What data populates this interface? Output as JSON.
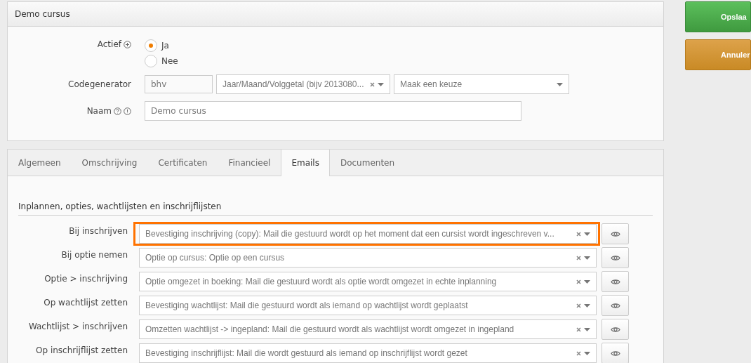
{
  "panel": {
    "title": "Demo cursus"
  },
  "form": {
    "actief": {
      "label": "Actief",
      "options": [
        {
          "label": "Ja",
          "selected": true
        },
        {
          "label": "Nee",
          "selected": false
        }
      ]
    },
    "codegenerator": {
      "label": "Codegenerator",
      "prefix": "bhv",
      "format": "Jaar/Maand/Volggetal (bijv 2013080...",
      "format_clearable": true,
      "choice_placeholder": "Maak een keuze"
    },
    "naam": {
      "label": "Naam",
      "value": "Demo cursus"
    }
  },
  "actions": [
    {
      "kind": "save",
      "label": "Opslaa"
    },
    {
      "kind": "cancel",
      "label": "Annuler"
    }
  ],
  "tabs": [
    {
      "label": "Algemeen",
      "selected": false
    },
    {
      "label": "Omschrijving",
      "selected": false
    },
    {
      "label": "Certificaten",
      "selected": false
    },
    {
      "label": "Financieel",
      "selected": false
    },
    {
      "label": "Emails",
      "selected": true
    },
    {
      "label": "Documenten",
      "selected": false
    }
  ],
  "section": {
    "title": "Inplannen, opties, wachtlijsten en inschrijflijsten",
    "rows": [
      {
        "label": "Bij inschrijven",
        "value": "Bevestiging inschrijving (copy): Mail die gestuurd wordt op het moment dat een cursist wordt ingeschreven v...",
        "highlighted": true
      },
      {
        "label": "Bij optie nemen",
        "value": "Optie op cursus: Optie op een cursus",
        "highlighted": false
      },
      {
        "label": "Optie > inschrijving",
        "value": "Optie omgezet in boeking: Mail die gestuurd wordt als optie wordt omgezet in echte inplanning",
        "highlighted": false
      },
      {
        "label": "Op wachtlijst zetten",
        "value": "Bevestiging wachtlijst: Mail die gestuurd wordt als iemand op wachtlijst wordt geplaatst",
        "highlighted": false
      },
      {
        "label": "Wachtlijst > inschrijven",
        "value": "Omzetten wachtlijst -> ingepland: Mail die gestuurd wordt als wachtlijst wordt omgezet in ingepland",
        "highlighted": false
      },
      {
        "label": "Op inschrijflijst zetten",
        "value": "Bevestiging inschrijflijst: Mail die wordt gestuurd als iemand op inschrijflijst wordt gezet",
        "highlighted": false
      }
    ]
  }
}
